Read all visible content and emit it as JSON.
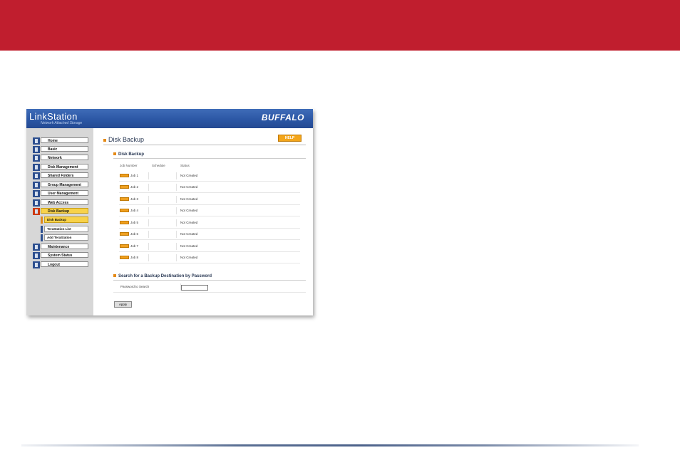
{
  "app": {
    "brand": "LinkStation",
    "brand_sub": "Network Attached Storage",
    "logo": "BUFFALO"
  },
  "colors": {
    "top_band": "#c01e2e",
    "header_blue": "#2a55a3",
    "accent_orange": "#f3a51a",
    "active_yellow": "#f8d24a"
  },
  "sidebar": {
    "items": [
      {
        "label": "Home",
        "icon": "home-icon"
      },
      {
        "label": "Basic",
        "icon": "basic-icon"
      },
      {
        "label": "Network",
        "icon": "network-icon"
      },
      {
        "label": "Disk Management",
        "icon": "disk-icon"
      },
      {
        "label": "Shared Folders",
        "icon": "folder-icon"
      },
      {
        "label": "Group Management",
        "icon": "group-icon"
      },
      {
        "label": "User Management",
        "icon": "user-icon"
      },
      {
        "label": "Web Access",
        "icon": "web-icon"
      },
      {
        "label": "Disk Backup",
        "icon": "backup-icon",
        "active": true
      },
      {
        "label": "Maintenance",
        "icon": "maintenance-icon"
      },
      {
        "label": "System Status",
        "icon": "status-icon"
      },
      {
        "label": "Logout",
        "icon": "logout-icon"
      }
    ],
    "subitems": [
      {
        "label": "Disk Backup",
        "active": true
      },
      {
        "label": "TeraStation List"
      },
      {
        "label": "Add TeraStation"
      }
    ]
  },
  "main": {
    "page_title": "Disk Backup",
    "help_label": "HELP",
    "section_title": "Disk Backup",
    "columns": [
      "Job Number",
      "Schedule",
      "Status"
    ],
    "jobs": [
      {
        "label": "Job 1",
        "schedule": "",
        "status": "Not Created"
      },
      {
        "label": "Job 2",
        "schedule": "",
        "status": "Not Created"
      },
      {
        "label": "Job 3",
        "schedule": "",
        "status": "Not Created"
      },
      {
        "label": "Job 4",
        "schedule": "",
        "status": "Not Created"
      },
      {
        "label": "Job 5",
        "schedule": "",
        "status": "Not Created"
      },
      {
        "label": "Job 6",
        "schedule": "",
        "status": "Not Created"
      },
      {
        "label": "Job 7",
        "schedule": "",
        "status": "Not Created"
      },
      {
        "label": "Job 8",
        "schedule": "",
        "status": "Not Created"
      }
    ],
    "search_section_title": "Search for a Backup Destination by Password",
    "password_label": "Password to Search",
    "password_value": "",
    "apply_label": "Apply"
  }
}
